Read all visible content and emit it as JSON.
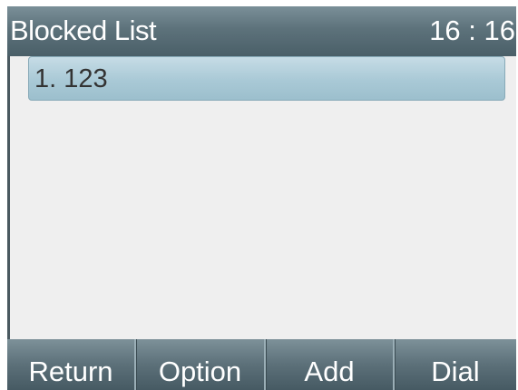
{
  "header": {
    "title": "Blocked List",
    "time": "16 : 16"
  },
  "list": {
    "items": [
      {
        "label": "1. 123",
        "selected": true
      }
    ]
  },
  "softkeys": {
    "return_label": "Return",
    "option_label": "Option",
    "add_label": "Add",
    "dial_label": "Dial"
  },
  "colors": {
    "title_bar": "#5d727b",
    "content_background": "#efefef",
    "selected_item": "#a9c9d6",
    "softkey_bar": "#5c7079",
    "text_light": "#ffffff",
    "text_dark": "#333333"
  }
}
